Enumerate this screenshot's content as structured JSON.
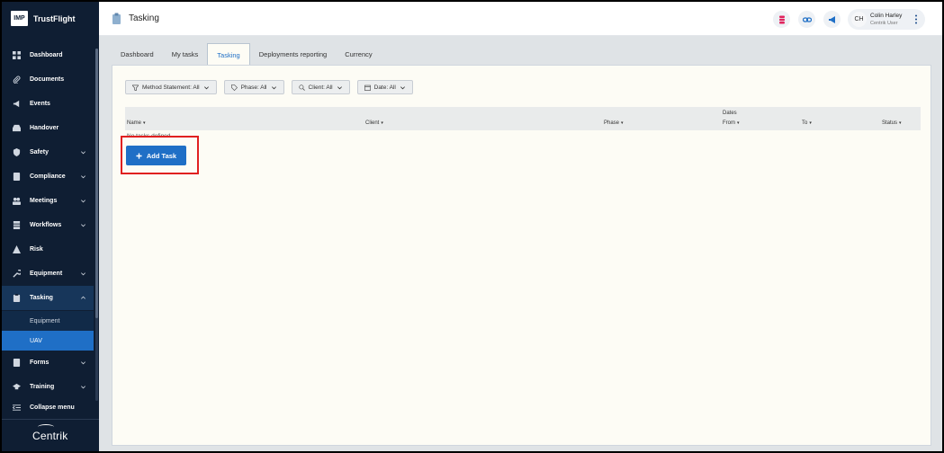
{
  "app": {
    "brand_mark": "IMP",
    "brand_name": "TrustFlight",
    "footer_logo": "Centrik"
  },
  "sidebar": {
    "items": [
      {
        "label": "Dashboard",
        "icon": "dashboard-icon",
        "has_submenu": false
      },
      {
        "label": "Documents",
        "icon": "paperclip-icon",
        "has_submenu": false
      },
      {
        "label": "Events",
        "icon": "megaphone-icon",
        "has_submenu": false
      },
      {
        "label": "Handover",
        "icon": "inbox-icon",
        "has_submenu": false
      },
      {
        "label": "Safety",
        "icon": "shield-icon",
        "has_submenu": true
      },
      {
        "label": "Compliance",
        "icon": "badge-icon",
        "has_submenu": true
      },
      {
        "label": "Meetings",
        "icon": "people-icon",
        "has_submenu": true
      },
      {
        "label": "Workflows",
        "icon": "workflow-icon",
        "has_submenu": true
      },
      {
        "label": "Risk",
        "icon": "warning-icon",
        "has_submenu": false
      },
      {
        "label": "Equipment",
        "icon": "wrench-icon",
        "has_submenu": true
      },
      {
        "label": "Tasking",
        "icon": "clipboard-icon",
        "has_submenu": true,
        "expanded": true
      },
      {
        "label": "Forms",
        "icon": "form-icon",
        "has_submenu": true
      },
      {
        "label": "Training",
        "icon": "graduation-cap-icon",
        "has_submenu": true
      }
    ],
    "tasking_subitems": [
      {
        "label": "Equipment",
        "active": false
      },
      {
        "label": "UAV",
        "active": true
      }
    ],
    "collapse_label": "Collapse menu"
  },
  "header": {
    "title": "Tasking",
    "icons": [
      "database-icon",
      "link-icon",
      "megaphone-icon"
    ],
    "user": {
      "initials": "CH",
      "name": "Colin Harley",
      "role": "Centrik User"
    }
  },
  "tabs": [
    {
      "label": "Dashboard",
      "active": false
    },
    {
      "label": "My tasks",
      "active": false
    },
    {
      "label": "Tasking",
      "active": true
    },
    {
      "label": "Deployments reporting",
      "active": false
    },
    {
      "label": "Currency",
      "active": false
    }
  ],
  "filters": [
    {
      "label": "Method Statement: All",
      "icon": "filter-icon"
    },
    {
      "label": "Phase: All",
      "icon": "tag-icon"
    },
    {
      "label": "Client: All",
      "icon": "search-icon"
    },
    {
      "label": "Date: All",
      "icon": "calendar-icon"
    }
  ],
  "table": {
    "group_header": "Dates",
    "columns": [
      "Name",
      "Client",
      "Phase",
      "From",
      "To",
      "Status"
    ],
    "empty_message": "No tasks defined.",
    "add_button_label": "Add Task"
  },
  "colors": {
    "sidebar_bg": "#0f1e33",
    "accent": "#1f6fc6",
    "highlight": "#e02020",
    "panel_bg": "#fdfcf5"
  }
}
